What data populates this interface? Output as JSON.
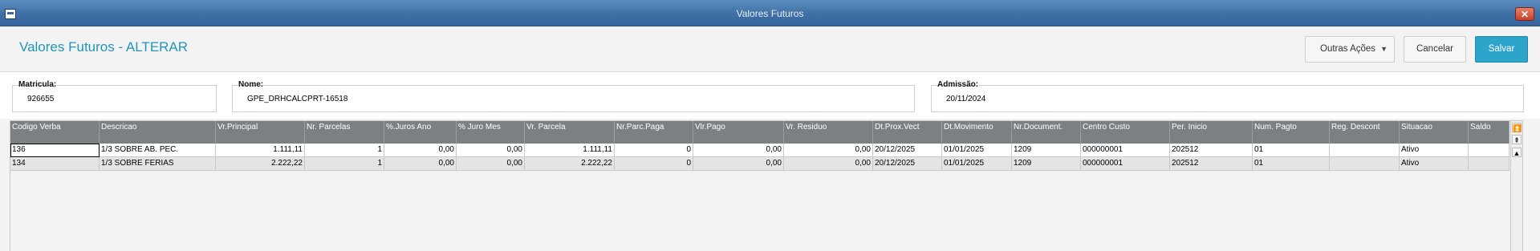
{
  "window": {
    "title": "Valores Futuros",
    "close_icon": "close-x-icon",
    "system_icon": "window-menu-icon"
  },
  "header": {
    "title": "Valores Futuros - ALTERAR",
    "more_actions_label": "Outras Ações",
    "cancel_label": "Cancelar",
    "save_label": "Salvar",
    "colors": {
      "title": "#2196b6",
      "save_button": "#2da4c9",
      "titlebar": "#3f6fa3"
    }
  },
  "fields": {
    "matricula": {
      "label": "Matricula:",
      "value": "926655"
    },
    "nome": {
      "label": "Nome:",
      "value": "GPE_DRHCALCPRT-16518"
    },
    "admissao": {
      "label": "Admissão:",
      "value": "20/11/2024"
    }
  },
  "grid": {
    "columns": [
      "Codigo Verba",
      "Descricao",
      "Vr.Principal",
      "Nr. Parcelas",
      "%.Juros Ano",
      "% Juro Mes",
      "Vr. Parcela",
      "Nr.Parc.Paga",
      "Vlr.Pago",
      "Vr. Residuo",
      "Dt.Prox.Vect",
      "Dt.Movimento",
      "Nr.Document.",
      "Centro Custo",
      "Per. Inicio",
      "Num. Pagto",
      "Reg. Descont",
      "Situacao",
      "Saldo"
    ],
    "rows": [
      [
        "136",
        "1/3 SOBRE AB. PEC.",
        "1.111,11",
        "1",
        "0,00",
        "0,00",
        "1.111,11",
        "0",
        "0,00",
        "0,00",
        "20/12/2025",
        "01/01/2025",
        "1209",
        "000000001",
        "202512",
        "01",
        "",
        "Ativo",
        ""
      ],
      [
        "134",
        "1/3 SOBRE FERIAS",
        "2.222,22",
        "1",
        "0,00",
        "0,00",
        "2.222,22",
        "0",
        "0,00",
        "0,00",
        "20/12/2025",
        "01/01/2025",
        "1209",
        "000000001",
        "202512",
        "01",
        "",
        "Ativo",
        ""
      ]
    ],
    "scroll_icons": [
      "scroll-first-icon",
      "scroll-page-up-icon",
      "scroll-up-icon"
    ]
  }
}
